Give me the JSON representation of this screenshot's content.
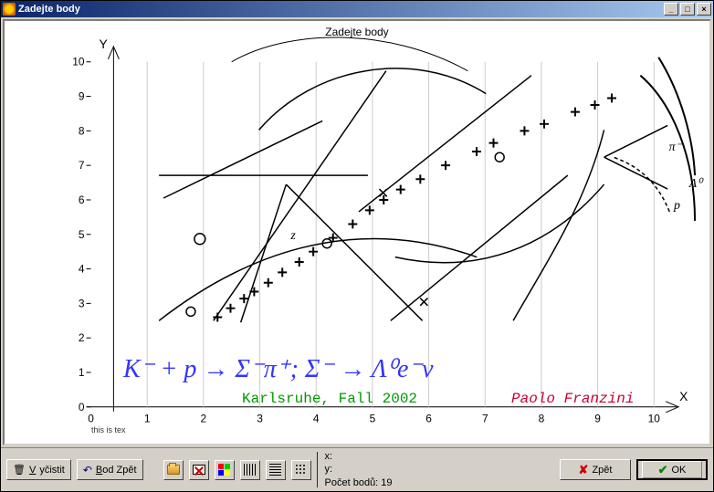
{
  "window": {
    "title": "Zadejte body"
  },
  "plot": {
    "title": "Zadejte body",
    "y_label": "Y",
    "x_label": "X",
    "y_ticks": [
      "0",
      "1",
      "2",
      "3",
      "4",
      "5",
      "6",
      "7",
      "8",
      "9",
      "10"
    ],
    "x_ticks": [
      "0",
      "1",
      "2",
      "3",
      "4",
      "5",
      "6",
      "7",
      "8",
      "9",
      "10"
    ],
    "latex_note": "this\nis\ntex",
    "formula": "K⁻ + p → Σ⁻π⁺;  Σ⁻ → Λ⁰e⁻ν",
    "credit1": "Karlsruhe, Fall 2002",
    "credit2": "Paolo Franzini",
    "annotations": {
      "pi_minus": "π⁻",
      "p": "p",
      "lambda0": "Λ⁰"
    },
    "points": [
      {
        "x": 2.25,
        "y": 2.6
      },
      {
        "x": 2.48,
        "y": 2.86
      },
      {
        "x": 2.72,
        "y": 3.14
      },
      {
        "x": 2.9,
        "y": 3.34
      },
      {
        "x": 3.15,
        "y": 3.6
      },
      {
        "x": 3.4,
        "y": 3.9
      },
      {
        "x": 3.7,
        "y": 4.2
      },
      {
        "x": 3.95,
        "y": 4.5
      },
      {
        "x": 4.3,
        "y": 4.9
      },
      {
        "x": 4.65,
        "y": 5.3
      },
      {
        "x": 4.95,
        "y": 5.7
      },
      {
        "x": 5.2,
        "y": 6.0
      },
      {
        "x": 5.5,
        "y": 6.3
      },
      {
        "x": 5.85,
        "y": 6.6
      },
      {
        "x": 6.3,
        "y": 7.0
      },
      {
        "x": 6.85,
        "y": 7.4
      },
      {
        "x": 7.15,
        "y": 7.65
      },
      {
        "x": 7.7,
        "y": 8.0
      },
      {
        "x": 8.05,
        "y": 8.2
      },
      {
        "x": 8.6,
        "y": 8.55
      },
      {
        "x": 8.95,
        "y": 8.75
      },
      {
        "x": 9.25,
        "y": 8.95
      }
    ]
  },
  "toolbar": {
    "clear": "Vyčistit",
    "undo_point": "Bod Zpět",
    "back": "Zpět",
    "ok": "OK"
  },
  "status": {
    "x_label": "x:",
    "y_label": "y:",
    "count_label": "Počet bodů: 19"
  }
}
